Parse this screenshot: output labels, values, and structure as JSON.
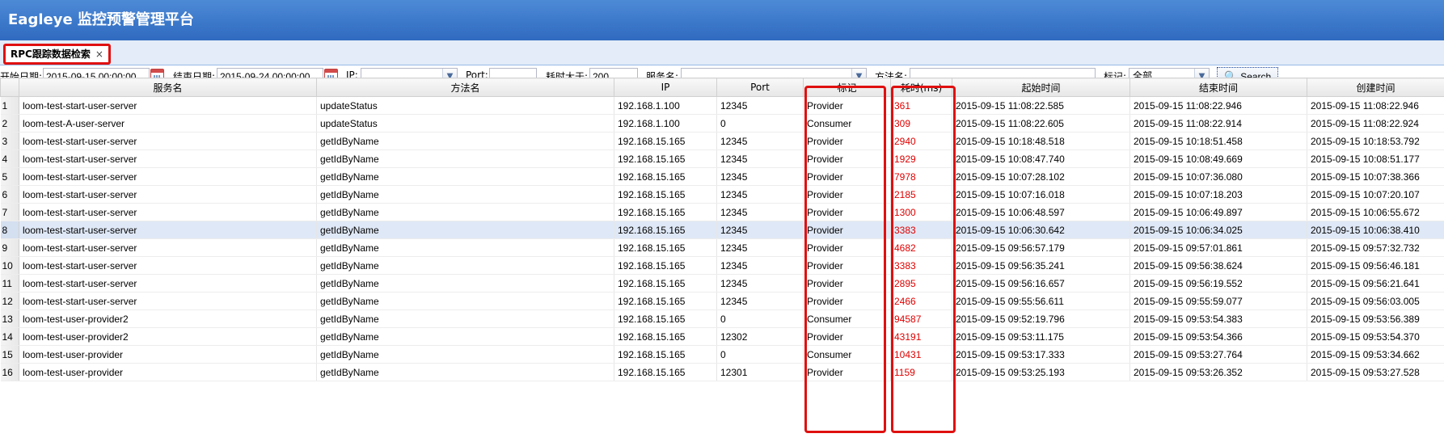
{
  "app": {
    "title": "Eagleye 监控预警管理平台"
  },
  "tab": {
    "label": "RPC跟踪数据检索",
    "close": "×"
  },
  "toolbar": {
    "start_label": "开始日期:",
    "start_value": "2015-09-15 00:00:00",
    "end_label": "结束日期:",
    "end_value": "2015-09-24 00:00:00",
    "ip_label": "IP:",
    "ip_value": "",
    "port_label": "Port:",
    "port_value": "",
    "cost_label": "耗时大于:",
    "cost_value": "200",
    "service_label": "服务名:",
    "service_value": "",
    "method_label": "方法名:",
    "method_value": "",
    "mark_label": "标记:",
    "mark_value": "全部",
    "search_label": "Search"
  },
  "grid": {
    "columns": [
      "服务名",
      "方法名",
      "IP",
      "Port",
      "标记",
      "耗时(ms)",
      "起始时间",
      "结束时间",
      "创建时间"
    ],
    "selected_row": 8,
    "rows": [
      {
        "n": "1",
        "service": "loom-test-start-user-server",
        "method": "updateStatus",
        "ip": "192.168.1.100",
        "port": "12345",
        "mark": "Provider",
        "cost": "361",
        "start": "2015-09-15 11:08:22.585",
        "end": "2015-09-15 11:08:22.946",
        "created": "2015-09-15 11:08:22.946"
      },
      {
        "n": "2",
        "service": "loom-test-A-user-server",
        "method": "updateStatus",
        "ip": "192.168.1.100",
        "port": "0",
        "mark": "Consumer",
        "cost": "309",
        "start": "2015-09-15 11:08:22.605",
        "end": "2015-09-15 11:08:22.914",
        "created": "2015-09-15 11:08:22.924"
      },
      {
        "n": "3",
        "service": "loom-test-start-user-server",
        "method": "getIdByName",
        "ip": "192.168.15.165",
        "port": "12345",
        "mark": "Provider",
        "cost": "2940",
        "start": "2015-09-15 10:18:48.518",
        "end": "2015-09-15 10:18:51.458",
        "created": "2015-09-15 10:18:53.792"
      },
      {
        "n": "4",
        "service": "loom-test-start-user-server",
        "method": "getIdByName",
        "ip": "192.168.15.165",
        "port": "12345",
        "mark": "Provider",
        "cost": "1929",
        "start": "2015-09-15 10:08:47.740",
        "end": "2015-09-15 10:08:49.669",
        "created": "2015-09-15 10:08:51.177"
      },
      {
        "n": "5",
        "service": "loom-test-start-user-server",
        "method": "getIdByName",
        "ip": "192.168.15.165",
        "port": "12345",
        "mark": "Provider",
        "cost": "7978",
        "start": "2015-09-15 10:07:28.102",
        "end": "2015-09-15 10:07:36.080",
        "created": "2015-09-15 10:07:38.366"
      },
      {
        "n": "6",
        "service": "loom-test-start-user-server",
        "method": "getIdByName",
        "ip": "192.168.15.165",
        "port": "12345",
        "mark": "Provider",
        "cost": "2185",
        "start": "2015-09-15 10:07:16.018",
        "end": "2015-09-15 10:07:18.203",
        "created": "2015-09-15 10:07:20.107"
      },
      {
        "n": "7",
        "service": "loom-test-start-user-server",
        "method": "getIdByName",
        "ip": "192.168.15.165",
        "port": "12345",
        "mark": "Provider",
        "cost": "1300",
        "start": "2015-09-15 10:06:48.597",
        "end": "2015-09-15 10:06:49.897",
        "created": "2015-09-15 10:06:55.672"
      },
      {
        "n": "8",
        "service": "loom-test-start-user-server",
        "method": "getIdByName",
        "ip": "192.168.15.165",
        "port": "12345",
        "mark": "Provider",
        "cost": "3383",
        "start": "2015-09-15 10:06:30.642",
        "end": "2015-09-15 10:06:34.025",
        "created": "2015-09-15 10:06:38.410"
      },
      {
        "n": "9",
        "service": "loom-test-start-user-server",
        "method": "getIdByName",
        "ip": "192.168.15.165",
        "port": "12345",
        "mark": "Provider",
        "cost": "4682",
        "start": "2015-09-15 09:56:57.179",
        "end": "2015-09-15 09:57:01.861",
        "created": "2015-09-15 09:57:32.732"
      },
      {
        "n": "10",
        "service": "loom-test-start-user-server",
        "method": "getIdByName",
        "ip": "192.168.15.165",
        "port": "12345",
        "mark": "Provider",
        "cost": "3383",
        "start": "2015-09-15 09:56:35.241",
        "end": "2015-09-15 09:56:38.624",
        "created": "2015-09-15 09:56:46.181"
      },
      {
        "n": "11",
        "service": "loom-test-start-user-server",
        "method": "getIdByName",
        "ip": "192.168.15.165",
        "port": "12345",
        "mark": "Provider",
        "cost": "2895",
        "start": "2015-09-15 09:56:16.657",
        "end": "2015-09-15 09:56:19.552",
        "created": "2015-09-15 09:56:21.641"
      },
      {
        "n": "12",
        "service": "loom-test-start-user-server",
        "method": "getIdByName",
        "ip": "192.168.15.165",
        "port": "12345",
        "mark": "Provider",
        "cost": "2466",
        "start": "2015-09-15 09:55:56.611",
        "end": "2015-09-15 09:55:59.077",
        "created": "2015-09-15 09:56:03.005"
      },
      {
        "n": "13",
        "service": "loom-test-user-provider2",
        "method": "getIdByName",
        "ip": "192.168.15.165",
        "port": "0",
        "mark": "Consumer",
        "cost": "94587",
        "start": "2015-09-15 09:52:19.796",
        "end": "2015-09-15 09:53:54.383",
        "created": "2015-09-15 09:53:56.389"
      },
      {
        "n": "14",
        "service": "loom-test-user-provider2",
        "method": "getIdByName",
        "ip": "192.168.15.165",
        "port": "12302",
        "mark": "Provider",
        "cost": "43191",
        "start": "2015-09-15 09:53:11.175",
        "end": "2015-09-15 09:53:54.366",
        "created": "2015-09-15 09:53:54.370"
      },
      {
        "n": "15",
        "service": "loom-test-user-provider",
        "method": "getIdByName",
        "ip": "192.168.15.165",
        "port": "0",
        "mark": "Consumer",
        "cost": "10431",
        "start": "2015-09-15 09:53:17.333",
        "end": "2015-09-15 09:53:27.764",
        "created": "2015-09-15 09:53:34.662"
      },
      {
        "n": "16",
        "service": "loom-test-user-provider",
        "method": "getIdByName",
        "ip": "192.168.15.165",
        "port": "12301",
        "mark": "Provider",
        "cost": "1159",
        "start": "2015-09-15 09:53:25.193",
        "end": "2015-09-15 09:53:26.352",
        "created": "2015-09-15 09:53:27.528"
      }
    ]
  },
  "colors": {
    "header": "#3b78cc",
    "highlight_border": "#e01010",
    "cost_text": "#e00000",
    "selected_row": "#dfe8f6"
  }
}
